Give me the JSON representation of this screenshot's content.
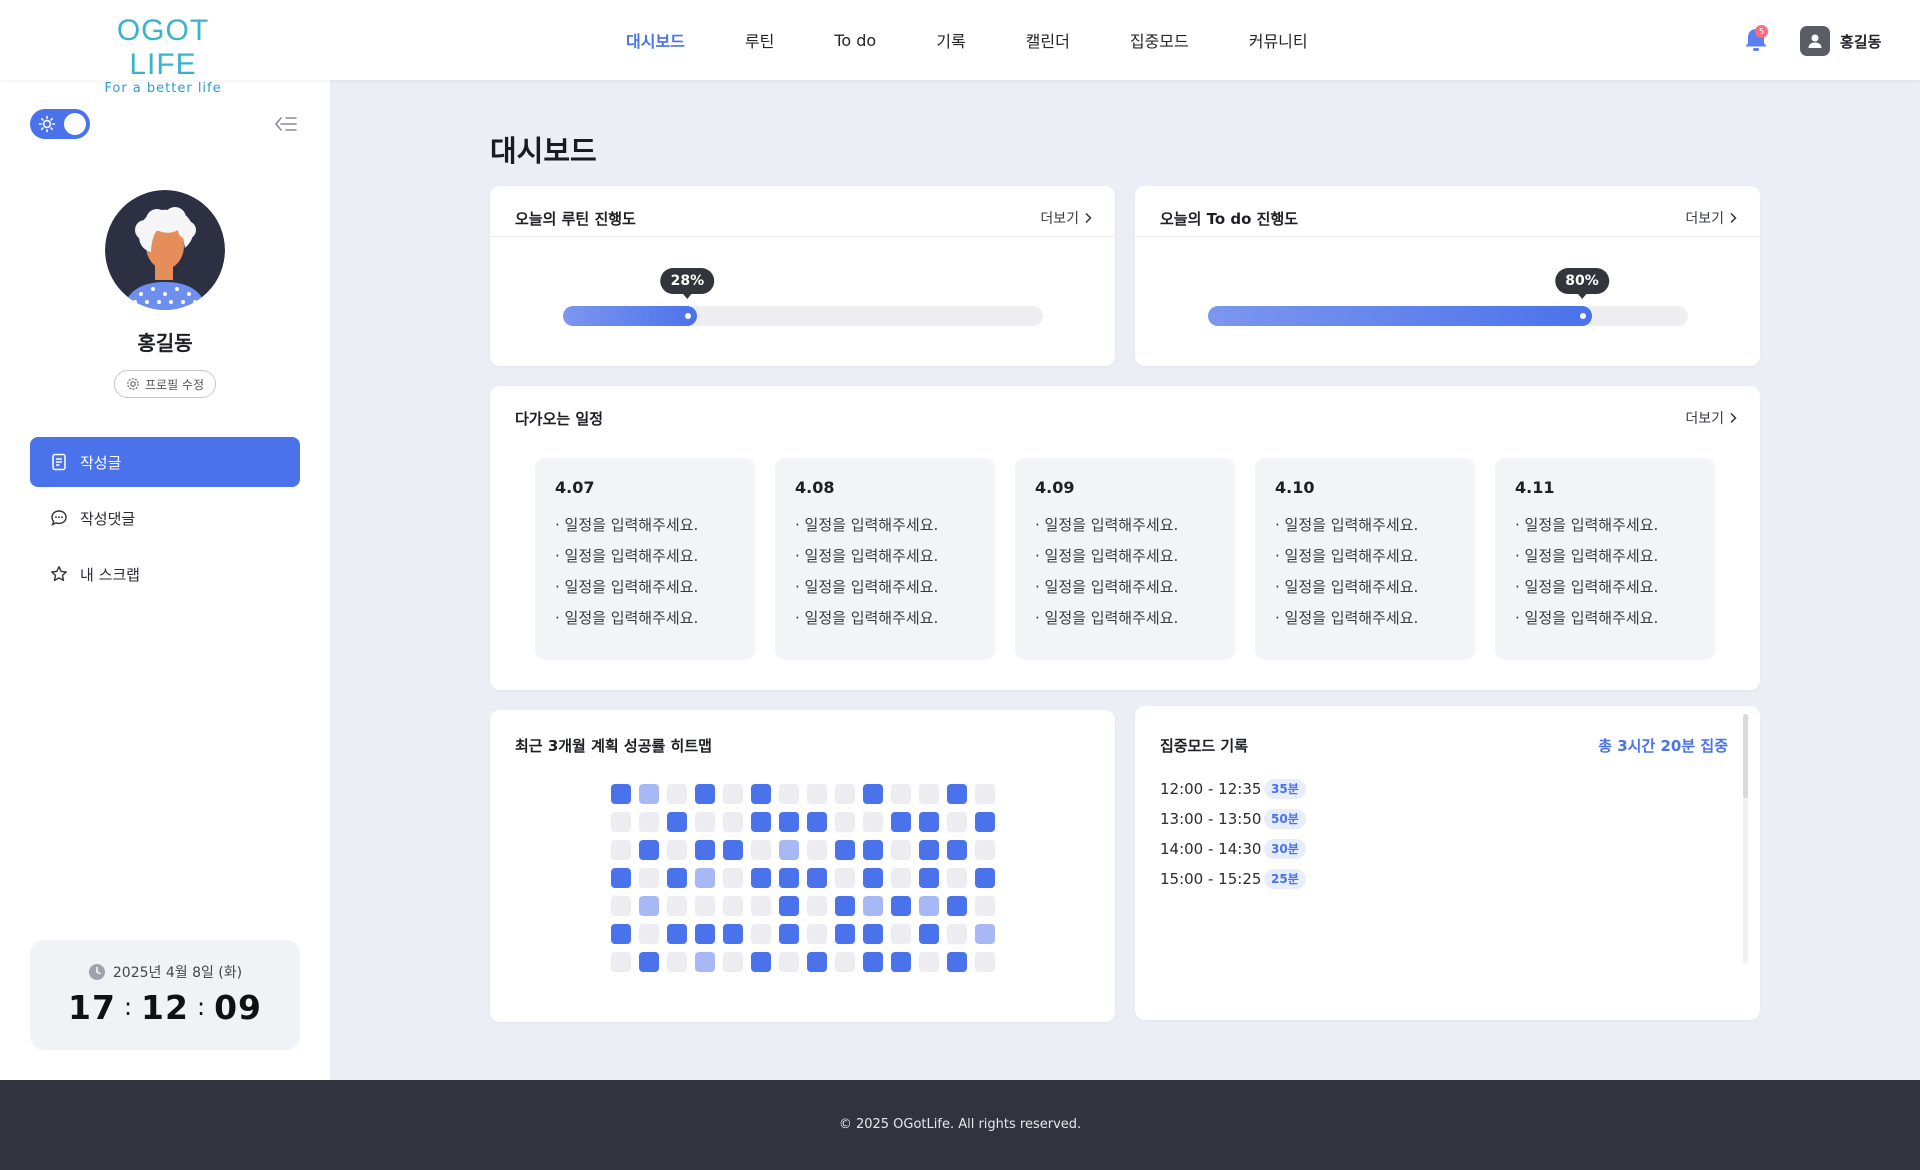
{
  "header": {
    "logo_main": "OGOT LIFE",
    "logo_sub": "For a better life",
    "nav": [
      "대시보드",
      "루틴",
      "To do",
      "기록",
      "캘린더",
      "집중모드",
      "커뮤니티"
    ],
    "notification_count": "5",
    "user_name": "홍길동"
  },
  "sidebar": {
    "profile_name": "홍길동",
    "profile_edit": "프로필 수정",
    "menu": [
      "작성글",
      "작성댓글",
      "내 스크랩"
    ],
    "clock": {
      "date": "2025년 4월 8일 (화)",
      "hours": "17",
      "minutes": "12",
      "seconds": "09"
    }
  },
  "main": {
    "title": "대시보드",
    "more_label": "더보기",
    "routine": {
      "title": "오늘의 루틴 진행도",
      "percent": 28,
      "percent_label": "28%"
    },
    "todo": {
      "title": "오늘의 To do 진행도",
      "percent": 80,
      "percent_label": "80%"
    },
    "schedule": {
      "title": "다가오는 일정",
      "days": [
        {
          "date": "4.07",
          "items": [
            "· 일정을 입력해주세요.",
            "· 일정을 입력해주세요.",
            "· 일정을 입력해주세요.",
            "· 일정을 입력해주세요."
          ]
        },
        {
          "date": "4.08",
          "items": [
            "· 일정을 입력해주세요.",
            "· 일정을 입력해주세요.",
            "· 일정을 입력해주세요.",
            "· 일정을 입력해주세요."
          ]
        },
        {
          "date": "4.09",
          "items": [
            "· 일정을 입력해주세요.",
            "· 일정을 입력해주세요.",
            "· 일정을 입력해주세요.",
            "· 일정을 입력해주세요."
          ]
        },
        {
          "date": "4.10",
          "items": [
            "· 일정을 입력해주세요.",
            "· 일정을 입력해주세요.",
            "· 일정을 입력해주세요.",
            "· 일정을 입력해주세요."
          ]
        },
        {
          "date": "4.11",
          "items": [
            "· 일정을 입력해주세요.",
            "· 일정을 입력해주세요.",
            "· 일정을 입력해주세요.",
            "· 일정을 입력해주세요."
          ]
        }
      ]
    },
    "heatmap": {
      "title": "최근 3개월 계획 성공률 히트맵",
      "levels": [
        [
          2,
          1,
          0,
          2,
          0,
          2,
          0,
          0,
          0,
          2,
          0,
          0,
          2,
          0
        ],
        [
          0,
          0,
          2,
          0,
          0,
          2,
          2,
          2,
          0,
          0,
          2,
          2,
          0,
          2
        ],
        [
          0,
          2,
          0,
          2,
          2,
          0,
          1,
          0,
          2,
          2,
          0,
          2,
          2,
          0
        ],
        [
          2,
          0,
          2,
          1,
          0,
          2,
          2,
          2,
          0,
          2,
          0,
          2,
          0,
          2
        ],
        [
          0,
          1,
          0,
          0,
          0,
          0,
          2,
          0,
          2,
          1,
          2,
          1,
          2,
          0
        ],
        [
          2,
          0,
          2,
          2,
          2,
          0,
          2,
          0,
          2,
          2,
          0,
          2,
          0,
          1
        ],
        [
          0,
          2,
          0,
          1,
          0,
          2,
          0,
          2,
          0,
          2,
          2,
          0,
          2,
          0
        ]
      ],
      "colors": [
        "#ededf1",
        "#a7b8f4",
        "#4a72ea"
      ]
    },
    "focus": {
      "title": "집중모드 기록",
      "total": "총 3시간 20분 집중",
      "records": [
        {
          "time": "12:00 - 12:35",
          "duration": "35분"
        },
        {
          "time": "13:00 - 13:50",
          "duration": "50분"
        },
        {
          "time": "14:00 - 14:30",
          "duration": "30분"
        },
        {
          "time": "15:00 - 15:25",
          "duration": "25분"
        }
      ]
    }
  },
  "footer": {
    "copyright": "© 2025 OGotLife. All rights reserved."
  },
  "colors": {
    "accent": "#4a72ea",
    "footer_bg": "#33333f",
    "page_bg": "#eceef5"
  }
}
